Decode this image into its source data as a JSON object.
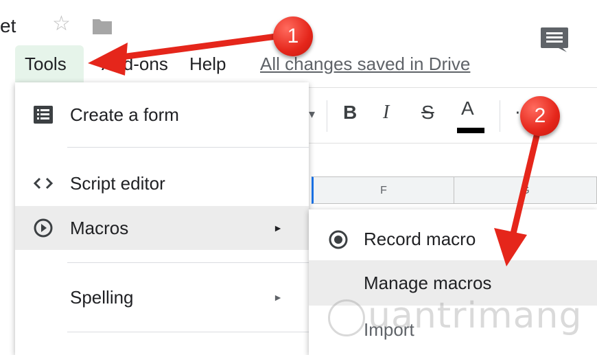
{
  "doc": {
    "title_fragment": "et"
  },
  "menubar": {
    "tools": "Tools",
    "addons": "Add-ons",
    "help": "Help",
    "saved_status": "All changes saved in Drive"
  },
  "toolbar": {
    "bold": "B",
    "italic": "I",
    "strikethrough": "S",
    "text_color": "A",
    "more": "⋯"
  },
  "grid": {
    "columns": [
      "F",
      "G"
    ]
  },
  "tools_menu": {
    "items": [
      {
        "label": "Create a form",
        "icon": "form-icon"
      },
      {
        "label": "Script editor",
        "icon": "code-icon"
      },
      {
        "label": "Macros",
        "icon": "play-circle-icon",
        "has_submenu": true,
        "highlighted": true
      },
      {
        "label": "Spelling",
        "has_submenu": true
      }
    ]
  },
  "macros_submenu": {
    "items": [
      {
        "label": "Record macro",
        "icon": "record-icon"
      },
      {
        "label": "Manage macros",
        "highlighted": true
      },
      {
        "label": "Import"
      }
    ]
  },
  "annotations": {
    "step1": "1",
    "step2": "2"
  },
  "watermark": {
    "text": "uantrimang"
  },
  "colors": {
    "annotation_red": "#e5261b",
    "tools_highlight": "#e6f4ea",
    "hover_gray": "#ececec",
    "selection_blue": "#1a73e8"
  }
}
